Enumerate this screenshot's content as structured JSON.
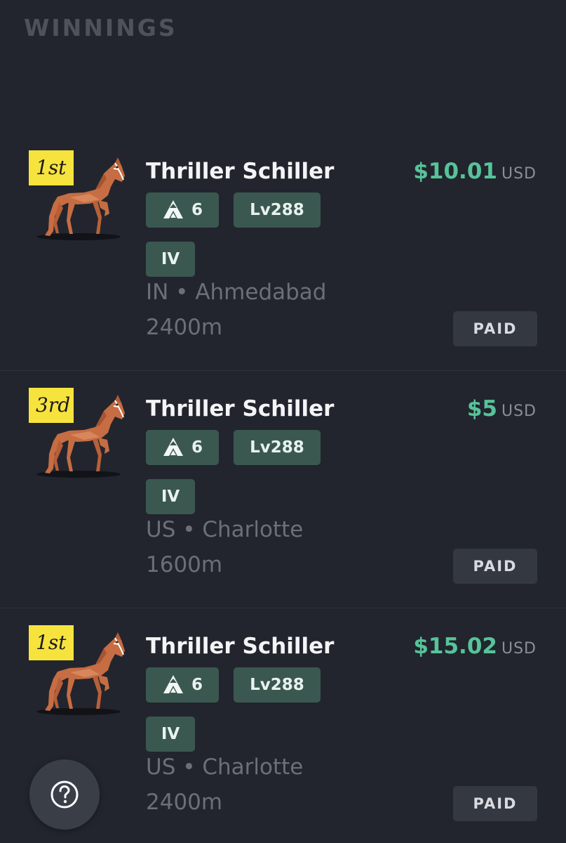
{
  "page": {
    "title": "WINNINGS"
  },
  "winnings": [
    {
      "place": "1st",
      "horse_name": "Thriller Schiller",
      "prize_amount": "$10.01",
      "currency": "USD",
      "generation": "6",
      "level": "Lv288",
      "race_class": "IV",
      "location": "IN • Ahmedabad",
      "distance": "2400m",
      "status": "PAID"
    },
    {
      "place": "3rd",
      "horse_name": "Thriller Schiller",
      "prize_amount": "$5",
      "currency": "USD",
      "generation": "6",
      "level": "Lv288",
      "race_class": "IV",
      "location": "US • Charlotte",
      "distance": "1600m",
      "status": "PAID"
    },
    {
      "place": "1st",
      "horse_name": "Thriller Schiller",
      "prize_amount": "$15.02",
      "currency": "USD",
      "generation": "6",
      "level": "Lv288",
      "race_class": "IV",
      "location": "US • Charlotte",
      "distance": "2400m",
      "status": "PAID"
    }
  ],
  "icons": {
    "generation": "generation-icon",
    "horse": "horse-icon",
    "help": "help-icon"
  },
  "colors": {
    "background": "#22252d",
    "prize_green": "#57c39a",
    "tag_green": "#3a5850",
    "place_badge_yellow": "#f7e33d",
    "status_button": "#343840"
  }
}
